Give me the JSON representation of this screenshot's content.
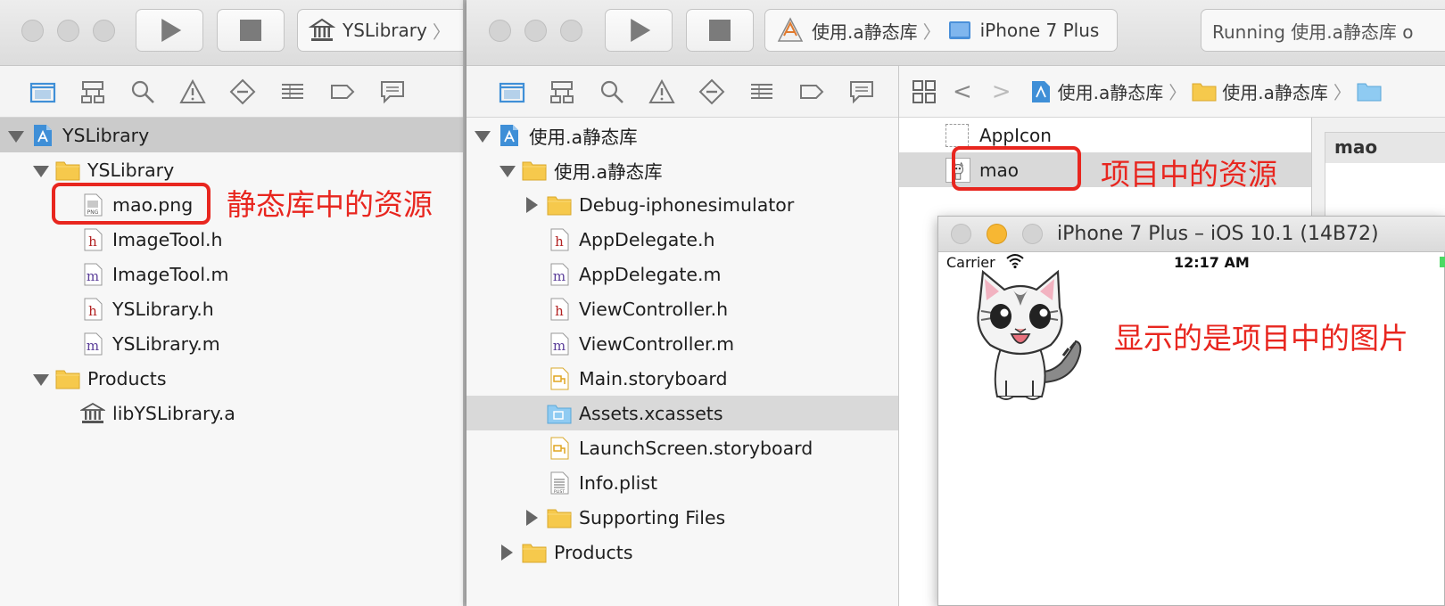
{
  "left_window": {
    "scheme_label": "YSLibrary",
    "tree": [
      {
        "label": "YSLibrary",
        "icon": "project-icon",
        "state": "open"
      },
      {
        "label": "YSLibrary",
        "icon": "folder-icon",
        "state": "open"
      },
      {
        "label": "mao.png",
        "icon": "png-file-icon"
      },
      {
        "label": "ImageTool.h",
        "icon": "h-file-icon"
      },
      {
        "label": "ImageTool.m",
        "icon": "m-file-icon"
      },
      {
        "label": "YSLibrary.h",
        "icon": "h-file-icon"
      },
      {
        "label": "YSLibrary.m",
        "icon": "m-file-icon"
      },
      {
        "label": "Products",
        "icon": "folder-icon",
        "state": "open"
      },
      {
        "label": "libYSLibrary.a",
        "icon": "library-icon"
      }
    ],
    "annotation": "静态库中的资源"
  },
  "right_window": {
    "scheme_target": "使用.a静态库",
    "scheme_device": "iPhone 7 Plus",
    "activity": "Running 使用.a静态库 o",
    "tree": [
      {
        "label": "使用.a静态库",
        "icon": "project-icon",
        "state": "open"
      },
      {
        "label": "使用.a静态库",
        "icon": "folder-icon",
        "state": "open"
      },
      {
        "label": "Debug-iphonesimulator",
        "icon": "folder-icon",
        "state": "closed"
      },
      {
        "label": "AppDelegate.h",
        "icon": "h-file-icon"
      },
      {
        "label": "AppDelegate.m",
        "icon": "m-file-icon"
      },
      {
        "label": "ViewController.h",
        "icon": "h-file-icon"
      },
      {
        "label": "ViewController.m",
        "icon": "m-file-icon"
      },
      {
        "label": "Main.storyboard",
        "icon": "storyboard-icon"
      },
      {
        "label": "Assets.xcassets",
        "icon": "assets-icon"
      },
      {
        "label": "LaunchScreen.storyboard",
        "icon": "storyboard-icon"
      },
      {
        "label": "Info.plist",
        "icon": "plist-icon"
      },
      {
        "label": "Supporting Files",
        "icon": "folder-icon",
        "state": "closed"
      },
      {
        "label": "Products",
        "icon": "folder-icon",
        "state": "closed"
      }
    ],
    "jump_bar": [
      "使用.a静态库",
      "使用.a静态库"
    ],
    "asset_list": [
      "AppIcon",
      "mao"
    ],
    "asset_detail_title": "mao",
    "annotation": "项目中的资源"
  },
  "simulator": {
    "title": "iPhone 7 Plus – iOS 10.1 (14B72)",
    "carrier": "Carrier",
    "time": "12:17 AM",
    "annotation": "显示的是项目中的图片"
  },
  "colors": {
    "annotation_red": "#e8261f",
    "xcode_blue": "#3f8fd7",
    "folder_yellow": "#f6c94c"
  }
}
